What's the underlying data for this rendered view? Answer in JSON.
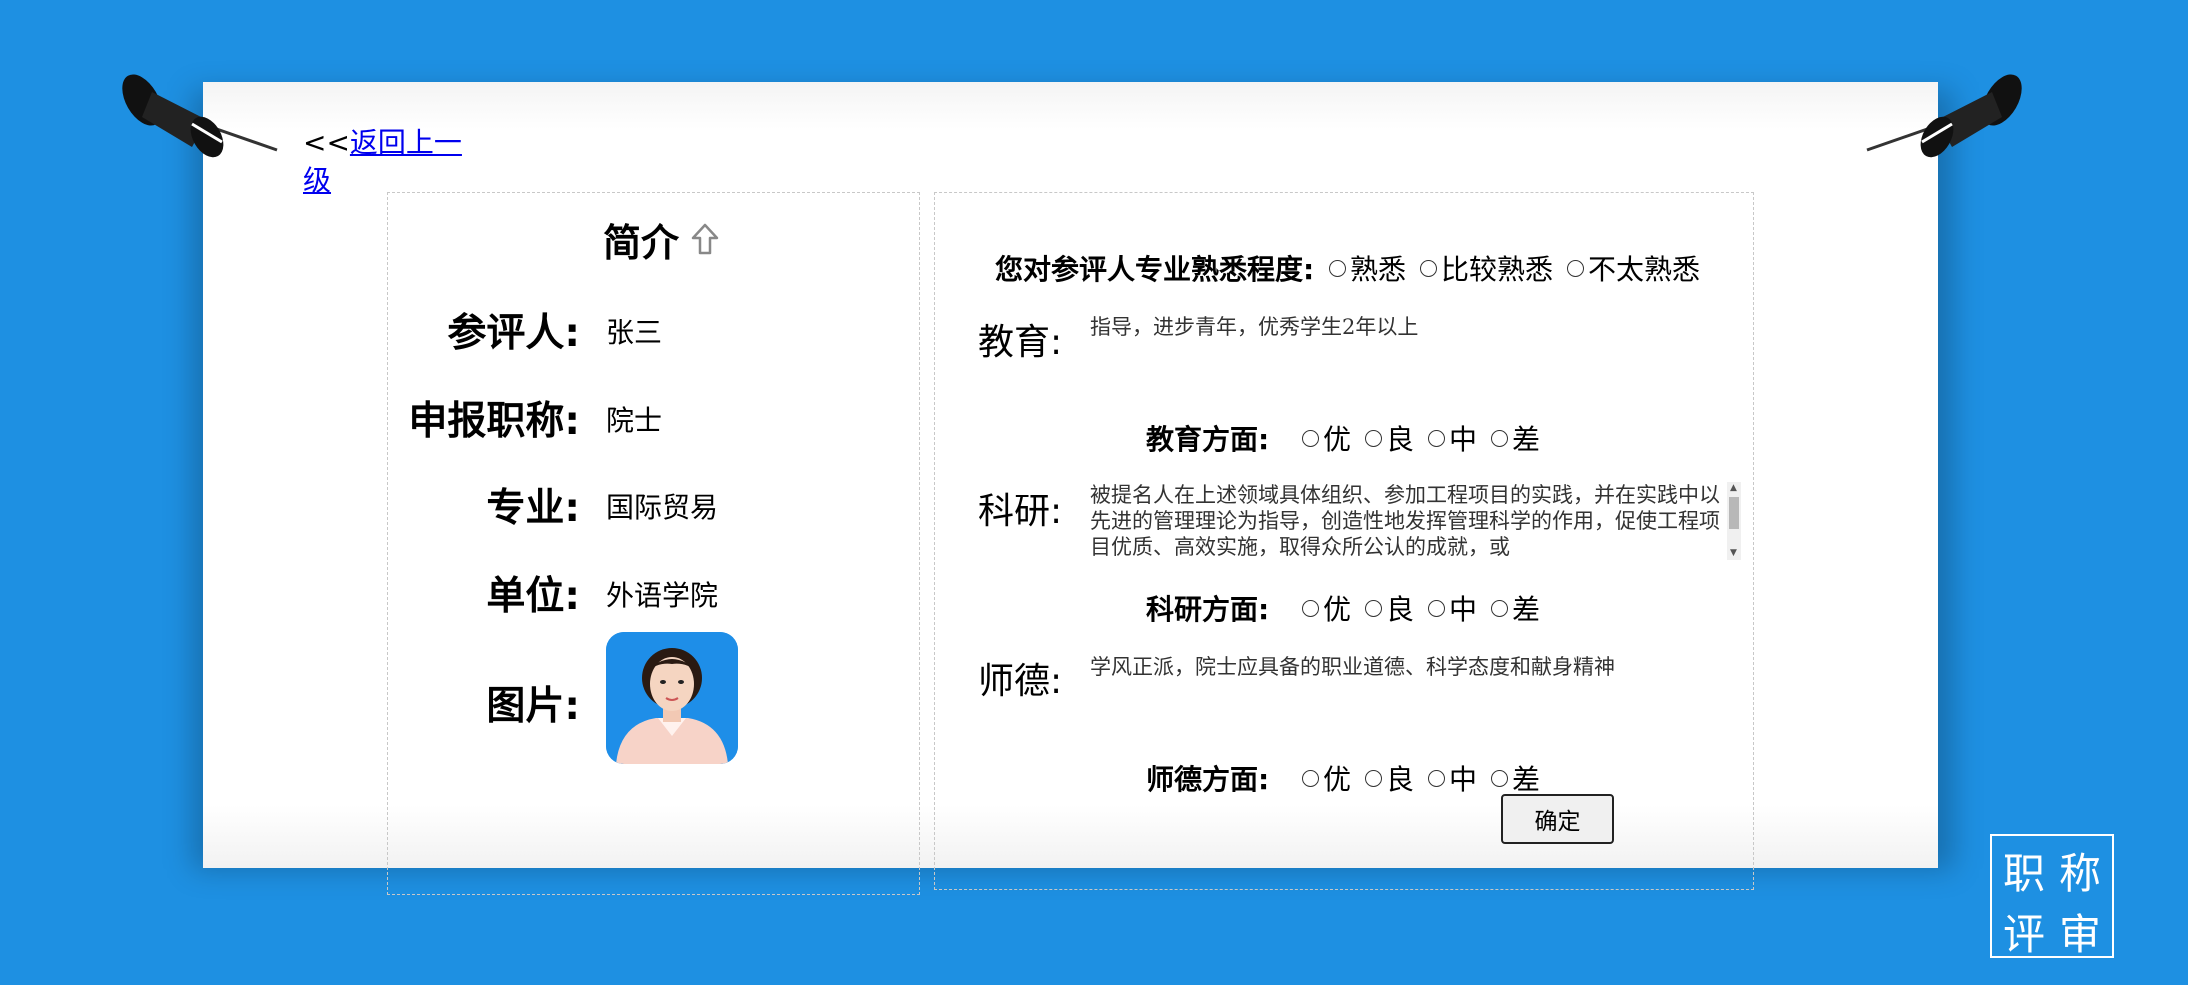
{
  "nav": {
    "back_prefix": "<<",
    "back_label": "返回上一级"
  },
  "intro": {
    "title": "简介",
    "items": [
      {
        "label": "参评人:",
        "value": "张三"
      },
      {
        "label": "申报职称:",
        "value": "院士"
      },
      {
        "label": "专业:",
        "value": "国际贸易"
      },
      {
        "label": "单位:",
        "value": "外语学院"
      },
      {
        "label": "图片:"
      }
    ]
  },
  "familiarity": {
    "label": "您对参评人专业熟悉程度:",
    "options": [
      "熟悉",
      "比较熟悉",
      "不太熟悉"
    ]
  },
  "sections": {
    "education": {
      "label": "教育:",
      "text": "指导，进步青年，优秀学生2年以上",
      "aspect_label": "教育方面:"
    },
    "research": {
      "label": "科研:",
      "text": "被提名人在上述领域具体组织、参加工程项目的实践，并在实践中以先进的管理理论为指导，创造性地发挥管理科学的作用，促使工程项目优质、高效实施，取得众所公认的成就，或",
      "aspect_label": "科研方面:"
    },
    "ethics": {
      "label": "师德:",
      "text": "学风正派，院士应具备的职业道德、科学态度和献身精神",
      "aspect_label": "师德方面:"
    }
  },
  "rating_options": [
    "优",
    "良",
    "中",
    "差"
  ],
  "confirm_label": "确定",
  "logo": {
    "chars": [
      "职",
      "称",
      "评",
      "审"
    ]
  },
  "colors": {
    "background": "#1e90e2",
    "paper": "#ffffff",
    "link": "#0000ee"
  }
}
